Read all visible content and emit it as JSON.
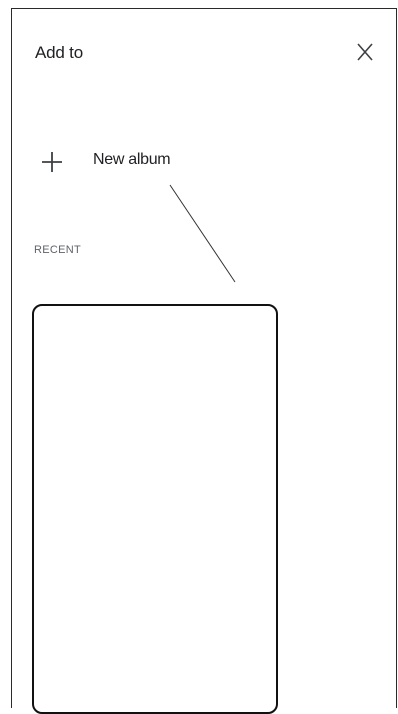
{
  "dialog": {
    "title": "Add to",
    "close_icon": "close-icon"
  },
  "actions": {
    "new_album_label": "New album",
    "new_album_icon": "plus-icon"
  },
  "sections": {
    "recent_label": "RECENT"
  },
  "colors": {
    "text": "#202124",
    "muted": "#5f6368",
    "border": "#2a2a2a"
  }
}
